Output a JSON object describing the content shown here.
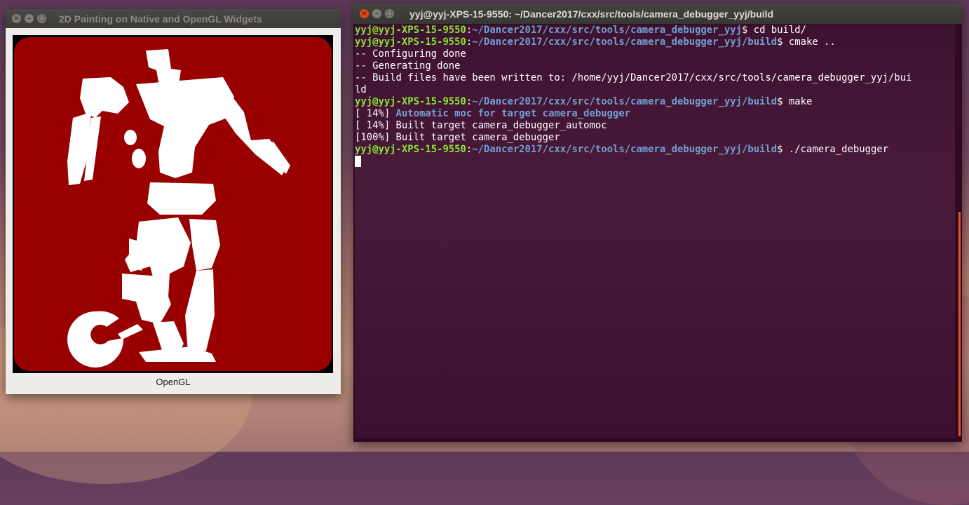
{
  "paint_window": {
    "title": "2D Painting on Native and OpenGL Widgets",
    "caption": "OpenGL",
    "colors": {
      "background_red": "#990000",
      "figure": "#ffffff",
      "border": "#000000"
    }
  },
  "terminal": {
    "title": "yyj@yyj-XPS-15-9550: ~/Dancer2017/cxx/src/tools/camera_debugger_yyj/build",
    "lines": [
      {
        "type": "prompt",
        "user": "yyj@yyj-XPS-15-9550",
        "path": "~/Dancer2017/cxx/src/tools/camera_debugger_yyj",
        "cmd": "$ cd build/"
      },
      {
        "type": "prompt",
        "user": "yyj@yyj-XPS-15-9550",
        "path": "~/Dancer2017/cxx/src/tools/camera_debugger_yyj/build",
        "cmd": "$ cmake .."
      },
      {
        "type": "out",
        "text": "-- Configuring done"
      },
      {
        "type": "out",
        "text": "-- Generating done"
      },
      {
        "type": "out",
        "text": "-- Build files have been written to: /home/yyj/Dancer2017/cxx/src/tools/camera_debugger_yyj/bui"
      },
      {
        "type": "out",
        "text": "ld"
      },
      {
        "type": "prompt",
        "user": "yyj@yyj-XPS-15-9550",
        "path": "~/Dancer2017/cxx/src/tools/camera_debugger_yyj/build",
        "cmd": "$ make"
      },
      {
        "type": "moc",
        "prefix": "[ 14%] ",
        "text": "Automatic moc for target camera_debugger"
      },
      {
        "type": "out",
        "text": "[ 14%] Built target camera_debugger_automoc"
      },
      {
        "type": "out",
        "text": "[100%] Built target camera_debugger"
      },
      {
        "type": "prompt",
        "user": "yyj@yyj-XPS-15-9550",
        "path": "~/Dancer2017/cxx/src/tools/camera_debugger_yyj/build",
        "cmd": "$ ./camera_debugger"
      }
    ],
    "colors": {
      "user": "#8ae234",
      "path": "#729fcf",
      "bg": "#300a24",
      "scrollbar": "#e95420"
    }
  }
}
